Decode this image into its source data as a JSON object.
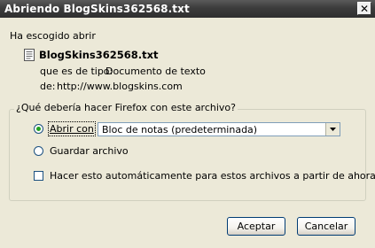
{
  "window": {
    "title": "Abriendo BlogSkins362568.txt",
    "close_label": "✕"
  },
  "intro": "Ha escogido abrir",
  "file": {
    "icon": "text-file-icon",
    "name": "BlogSkins362568.txt",
    "type_label": "que es de tipo:",
    "type_value": "Documento de texto",
    "from_label": "de:",
    "from_value": "http://www.blogskins.com"
  },
  "question": "¿Qué debería hacer Firefox con este archivo?",
  "options": {
    "open_with_label": "Abrir con",
    "open_with_app": "Bloc de notas (predeterminada)",
    "save_label": "Guardar archivo",
    "selected": "open_with"
  },
  "auto_label": "Hacer esto automáticamente para estos archivos a partir de ahora.",
  "auto_checked": false,
  "buttons": {
    "accept": "Aceptar",
    "cancel": "Cancelar"
  }
}
